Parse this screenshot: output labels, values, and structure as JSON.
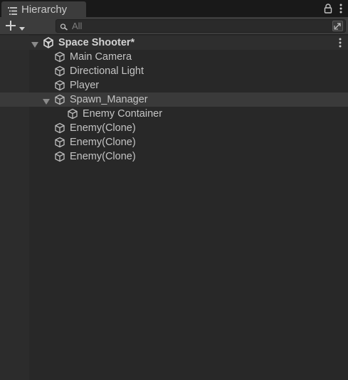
{
  "window": {
    "tab_icon": "hierarchy-list-icon",
    "tab_title": "Hierarchy",
    "lock_icon": "lock-icon",
    "menu_icon": "kebab-menu-icon"
  },
  "toolbar": {
    "create_icon": "plus-icon",
    "dropdown_icon": "triangle-down-icon",
    "search_placeholder": "All",
    "search_icon": "search-icon",
    "expand_icon": "expand-search-icon"
  },
  "hierarchy": {
    "scene": {
      "name": "Space Shooter*",
      "icon": "unity-scene-icon",
      "expanded": true
    },
    "items": [
      {
        "name": "Main Camera",
        "icon": "gameobject-cube-icon",
        "depth": 1,
        "has_children": false,
        "selected": false
      },
      {
        "name": "Directional Light",
        "icon": "gameobject-cube-icon",
        "depth": 1,
        "has_children": false,
        "selected": false
      },
      {
        "name": "Player",
        "icon": "gameobject-cube-icon",
        "depth": 1,
        "has_children": false,
        "selected": false
      },
      {
        "name": "Spawn_Manager",
        "icon": "gameobject-cube-icon",
        "depth": 1,
        "has_children": true,
        "expanded": true,
        "selected": true
      },
      {
        "name": "Enemy Container",
        "icon": "gameobject-cube-icon",
        "depth": 2,
        "has_children": false,
        "selected": false
      },
      {
        "name": "Enemy(Clone)",
        "icon": "gameobject-cube-icon",
        "depth": 1,
        "has_children": false,
        "selected": false
      },
      {
        "name": "Enemy(Clone)",
        "icon": "gameobject-cube-icon",
        "depth": 1,
        "has_children": false,
        "selected": false
      },
      {
        "name": "Enemy(Clone)",
        "icon": "gameobject-cube-icon",
        "depth": 1,
        "has_children": false,
        "selected": false
      }
    ]
  }
}
